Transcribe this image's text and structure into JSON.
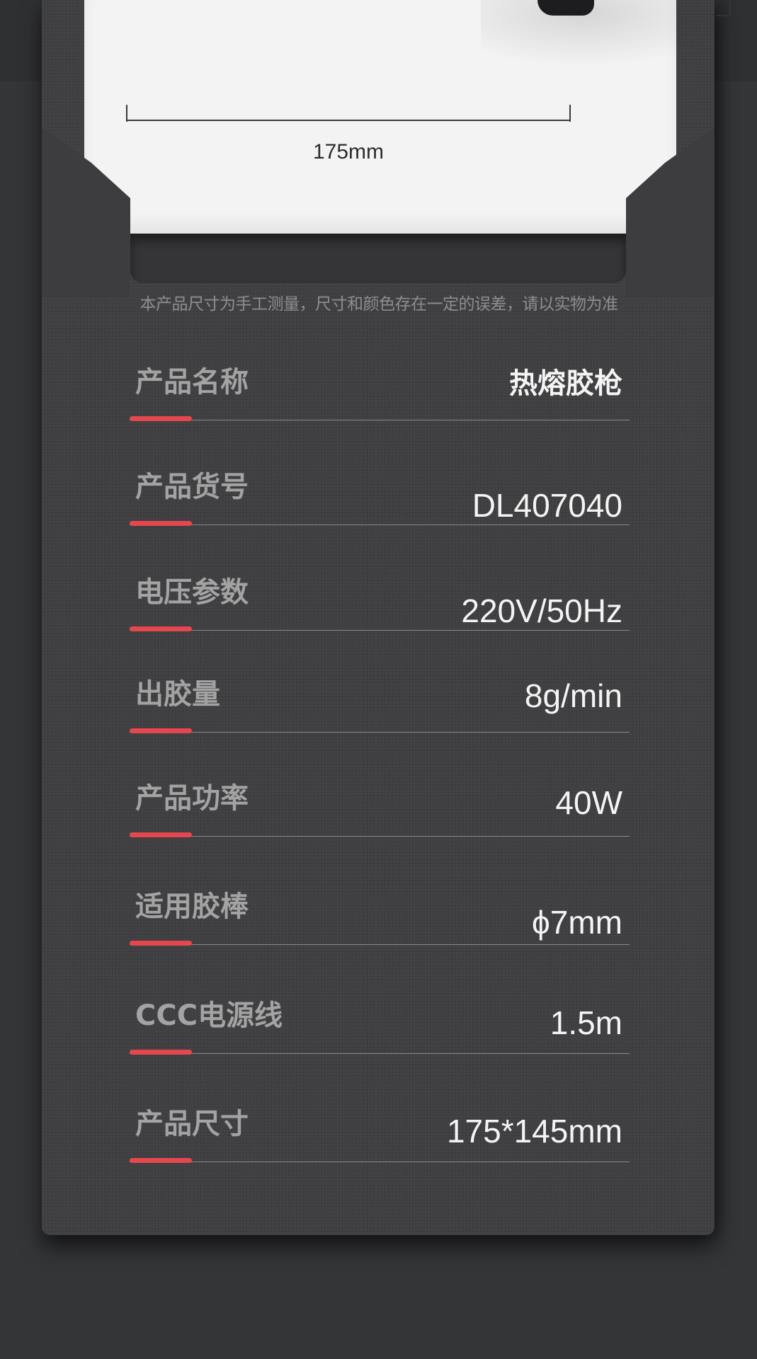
{
  "dimension": {
    "width_label": "175mm"
  },
  "disclaimer": "本产品尺寸为手工测量，尺寸和颜色存在一定的误差，请以实物为准",
  "specs": [
    {
      "label": "产品名称",
      "value": "热熔胶枪"
    },
    {
      "label": "产品货号",
      "value": "DL407040"
    },
    {
      "label": "电压参数",
      "value": "220V/50Hz"
    },
    {
      "label": "出胶量",
      "value": "8g/min"
    },
    {
      "label": "产品功率",
      "value": "40W"
    },
    {
      "label": "适用胶棒",
      "value": "ϕ7mm"
    },
    {
      "label": "CCC电源线",
      "value": "1.5m"
    },
    {
      "label": "产品尺寸",
      "value": "175*145mm"
    }
  ],
  "colors": {
    "background": "#343537",
    "card": "#404042",
    "accent": "#e5474f",
    "label": "#a3a3a4",
    "value": "#f4f4f4"
  }
}
